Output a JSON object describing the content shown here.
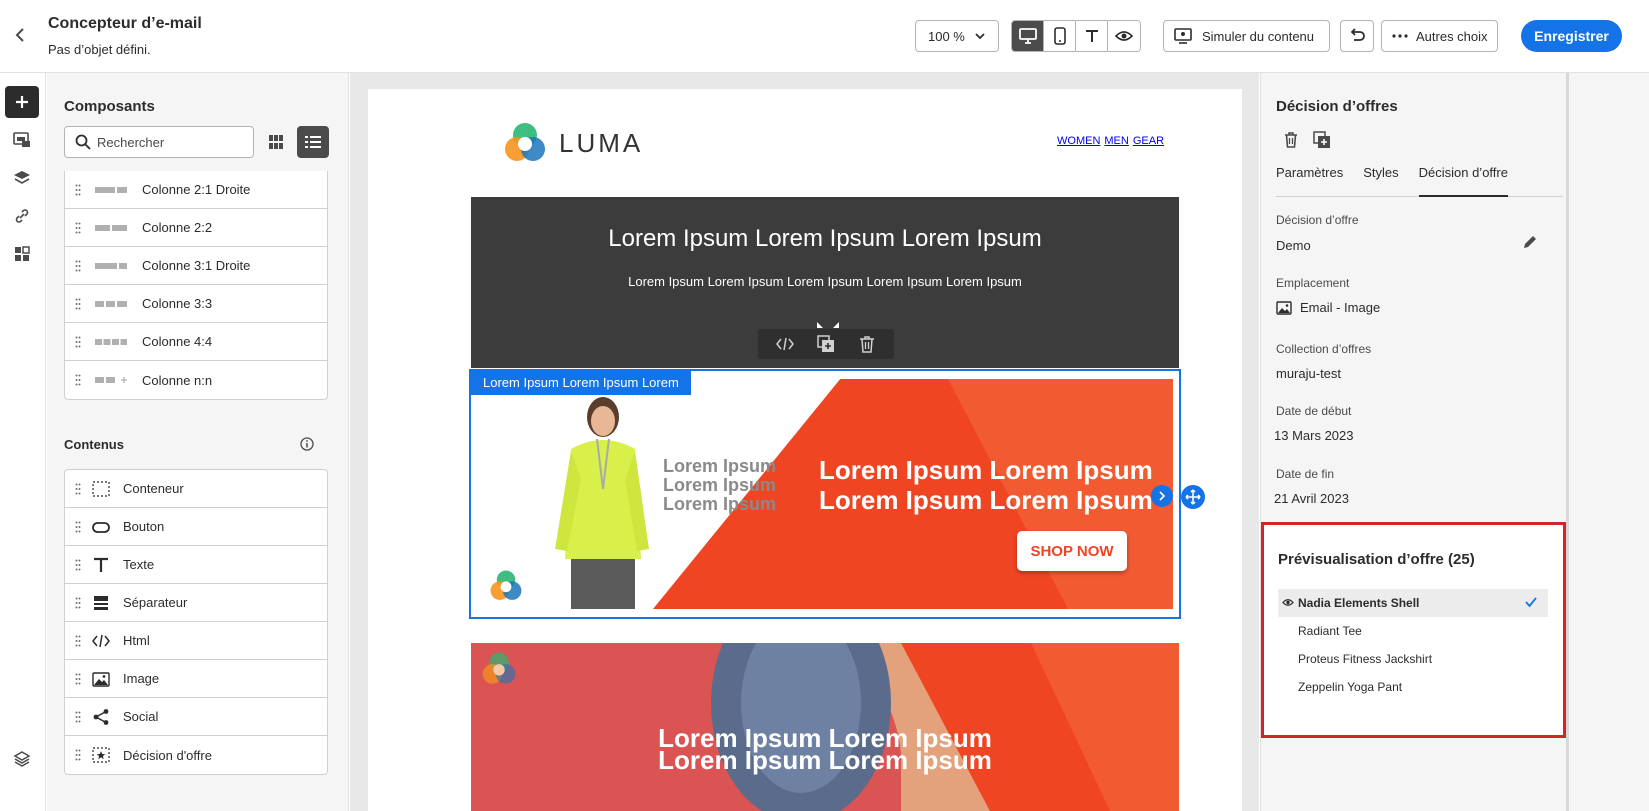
{
  "header": {
    "title": "Concepteur d’e-mail",
    "subtitle": "Pas d’objet défini.",
    "zoom": "100 %",
    "simulate_label": "Simuler du contenu",
    "more_label": "Autres choix",
    "save_label": "Enregistrer"
  },
  "components": {
    "title": "Composants",
    "search_placeholder": "Rechercher",
    "structures": [
      {
        "label": "Colonne 2:1 Droite",
        "icon": "column-2-1-right-icon"
      },
      {
        "label": "Colonne 2:2",
        "icon": "column-2-2-icon"
      },
      {
        "label": "Colonne 3:1 Droite",
        "icon": "column-3-1-right-icon"
      },
      {
        "label": "Colonne 3:3",
        "icon": "column-3-3-icon"
      },
      {
        "label": "Colonne 4:4",
        "icon": "column-4-4-icon"
      },
      {
        "label": "Colonne n:n",
        "icon": "column-n-n-icon"
      }
    ],
    "contents_title": "Contenus",
    "contents": [
      {
        "label": "Conteneur",
        "icon": "container-icon"
      },
      {
        "label": "Bouton",
        "icon": "button-icon"
      },
      {
        "label": "Texte",
        "icon": "text-icon"
      },
      {
        "label": "Séparateur",
        "icon": "divider-icon"
      },
      {
        "label": "Html",
        "icon": "code-icon"
      },
      {
        "label": "Image",
        "icon": "image-icon"
      },
      {
        "label": "Social",
        "icon": "share-icon"
      },
      {
        "label": "Décision d'offre",
        "icon": "offer-decision-icon"
      }
    ]
  },
  "email": {
    "logo_text": "LUMA",
    "nav": [
      "WOMEN",
      "MEN",
      "GEAR"
    ],
    "hero_heading": "Lorem Ipsum Lorem Ipsum Lorem Ipsum",
    "hero_text": "Lorem Ipsum Lorem Ipsum Lorem Ipsum Lorem Ipsum Lorem Ipsum",
    "offer_label": "Lorem Ipsum Lorem Ipsum Lorem",
    "banner_gray": "Lorem Ipsum Lorem Ipsum Lorem Ipsum",
    "banner_white": "Lorem Ipsum Lorem Ipsum Lorem Ipsum Lorem Ipsum",
    "shop_now": "SHOP NOW",
    "yoga_line1": "Lorem Ipsum Lorem Ipsum",
    "yoga_line2": "Lorem Ipsum Lorem Ipsum"
  },
  "offer_panel": {
    "title": "Décision d’offres",
    "tabs": [
      "Paramètres",
      "Styles",
      "Décision d’offre"
    ],
    "active_tab": "Décision d’offre",
    "decision_label": "Décision d’offre",
    "decision_value": "Demo",
    "placement_label": "Emplacement",
    "placement_value": "Email - Image",
    "collection_label": "Collection d’offres",
    "collection_value": "muraju-test",
    "start_label": "Date de début",
    "start_value": "13 Mars 2023",
    "end_label": "Date de fin",
    "end_value": "21 Avril 2023"
  },
  "preview": {
    "title": "Prévisualisation d’offre (25)",
    "items": [
      "Nadia Elements Shell",
      "Radiant Tee",
      "Proteus Fitness Jackshirt",
      "Zeppelin Yoga Pant"
    ],
    "selected": "Nadia Elements Shell"
  },
  "colors": {
    "accent": "#1473e6",
    "highlight_border": "#d3242a",
    "banner_red": "#ef4523",
    "hero_bg": "#3c3c3c"
  }
}
